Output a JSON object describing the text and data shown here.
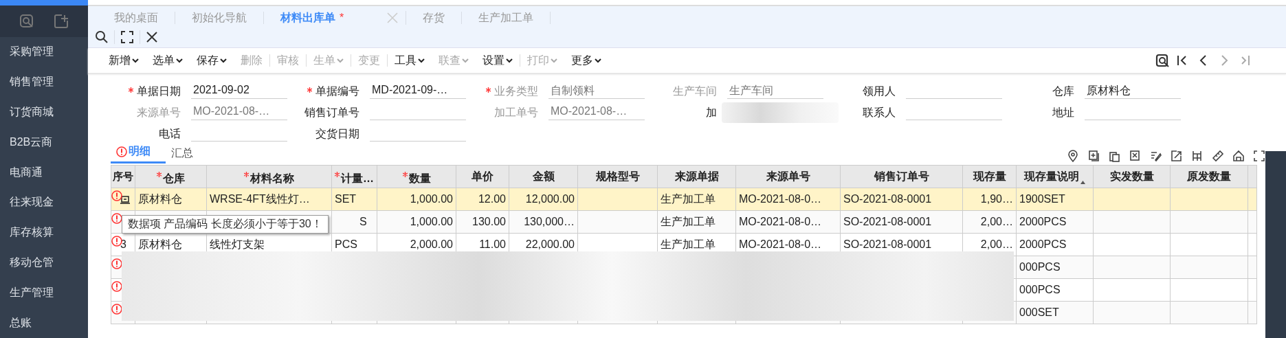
{
  "sidebar": {
    "items": [
      {
        "label": "采购管理"
      },
      {
        "label": "销售管理"
      },
      {
        "label": "订货商城"
      },
      {
        "label": "B2B云商"
      },
      {
        "label": "电商通"
      },
      {
        "label": "往来现金"
      },
      {
        "label": "库存核算"
      },
      {
        "label": "移动仓管"
      },
      {
        "label": "生产管理"
      },
      {
        "label": "总账"
      }
    ]
  },
  "tabs": [
    {
      "label": "我的桌面",
      "selected": false,
      "modified": false
    },
    {
      "label": "初始化导航",
      "selected": false,
      "modified": false
    },
    {
      "label": "材料出库单",
      "selected": true,
      "modified": true,
      "modified_mark": "*"
    },
    {
      "label": "存货",
      "selected": false,
      "modified": false
    },
    {
      "label": "生产加工单",
      "selected": false,
      "modified": false
    }
  ],
  "toolbar": {
    "buttons": [
      {
        "label": "新增",
        "dropdown": true,
        "disabled": false,
        "divider_after": false
      },
      {
        "label": "选单",
        "dropdown": true,
        "disabled": false,
        "divider_after": false
      },
      {
        "label": "保存",
        "dropdown": true,
        "disabled": false,
        "divider_after": false
      },
      {
        "label": "删除",
        "dropdown": false,
        "disabled": true,
        "divider_after": true
      },
      {
        "label": "审核",
        "dropdown": false,
        "disabled": true,
        "divider_after": true
      },
      {
        "label": "生单",
        "dropdown": true,
        "disabled": true,
        "divider_after": true
      },
      {
        "label": "变更",
        "dropdown": false,
        "disabled": true,
        "divider_after": true
      },
      {
        "label": "工具",
        "dropdown": true,
        "disabled": false,
        "divider_after": false
      },
      {
        "label": "联查",
        "dropdown": true,
        "disabled": true,
        "divider_after": false
      },
      {
        "label": "设置",
        "dropdown": true,
        "disabled": false,
        "divider_after": true
      },
      {
        "label": "打印",
        "dropdown": true,
        "disabled": true,
        "divider_after": false
      },
      {
        "label": "更多",
        "dropdown": true,
        "disabled": false,
        "divider_after": false
      }
    ],
    "nav": [
      {
        "kind": "first",
        "disabled": false
      },
      {
        "kind": "prev",
        "disabled": false
      },
      {
        "kind": "next",
        "disabled": true
      },
      {
        "kind": "last",
        "disabled": true
      }
    ]
  },
  "form": {
    "fields": [
      {
        "label": "单据日期",
        "value": "2021-09-02",
        "required": true,
        "disabled": false
      },
      {
        "label": "单据编号",
        "value": "MD-2021-09-…",
        "required": true,
        "disabled": false
      },
      {
        "label": "业务类型",
        "value": "自制领料",
        "required": true,
        "disabled": true
      },
      {
        "label": "生产车间",
        "value": "生产车间",
        "required": false,
        "disabled": true
      },
      {
        "label": "领用人",
        "required": false,
        "disabled": false
      },
      {
        "label": "仓库",
        "value": "原材料仓",
        "required": false,
        "disabled": false
      },
      {
        "label": "来源单号",
        "value": "MO-2021-08-…",
        "required": false,
        "disabled": true
      },
      {
        "label": "销售订单号",
        "required": false,
        "disabled": false
      },
      {
        "label": "加工单号",
        "value": "MO-2021-08-…",
        "required": false,
        "disabled": true
      },
      {
        "label": "加",
        "required": false,
        "disabled": false,
        "blurred": true
      },
      {
        "label": "联系人",
        "required": false,
        "disabled": false
      },
      {
        "label": "地址",
        "required": false,
        "disabled": false
      },
      {
        "label": "电话",
        "required": false,
        "disabled": false
      },
      {
        "label": "交货日期",
        "required": false,
        "disabled": false
      }
    ]
  },
  "detail_tabs": [
    {
      "label": "明细",
      "selected": true,
      "error": true
    },
    {
      "label": "汇总",
      "selected": false,
      "error": false
    }
  ],
  "table": {
    "columns": [
      {
        "label": "序号",
        "required": false
      },
      {
        "label": "仓库",
        "required": true
      },
      {
        "label": "材料名称",
        "required": true
      },
      {
        "label": "计量…",
        "required": true
      },
      {
        "label": "数量",
        "required": true
      },
      {
        "label": "单价",
        "required": false
      },
      {
        "label": "金额",
        "required": false
      },
      {
        "label": "规格型号",
        "required": false
      },
      {
        "label": "来源单据",
        "required": false
      },
      {
        "label": "来源单号",
        "required": false
      },
      {
        "label": "销售订单号",
        "required": false
      },
      {
        "label": "现存量",
        "required": false
      },
      {
        "label": "现存量说明",
        "required": false,
        "sorted": true
      },
      {
        "label": "实发数量",
        "required": false
      },
      {
        "label": "原发数量",
        "required": false
      }
    ],
    "rows": [
      {
        "selected": true,
        "error": true,
        "editing": true,
        "cells": [
          null,
          "原材料仓",
          "WRSE-4FT线性灯…",
          "SET",
          "1,000.00",
          "12.00",
          "12,000.00",
          null,
          "生产加工单",
          "MO-2021-08-0…",
          "SO-2021-08-0001",
          "1,90…",
          "1900SET",
          null,
          null
        ]
      },
      {
        "selected": false,
        "error": true,
        "editing": false,
        "tooltip": "数据项 产品编码 长度必须小于等于30！",
        "cells": [
          null,
          null,
          null,
          "S",
          "1,000.00",
          "130.00",
          "130,000…",
          null,
          "生产加工单",
          "MO-2021-08-0…",
          "SO-2021-08-0001",
          "2,00…",
          "2000PCS",
          null,
          null
        ]
      },
      {
        "selected": false,
        "error": true,
        "editing": false,
        "cells": [
          "3",
          "原材料仓",
          "线性灯支架",
          "PCS",
          "2,000.00",
          "11.00",
          "22,000.00",
          null,
          "生产加工单",
          "MO-2021-08-0…",
          "SO-2021-08-0001",
          "2,00…",
          "2000PCS",
          null,
          null
        ]
      },
      {
        "selected": false,
        "error": true,
        "editing": false,
        "cells": [
          null,
          null,
          null,
          null,
          null,
          null,
          null,
          null,
          null,
          null,
          null,
          null,
          "000PCS",
          null,
          null
        ]
      },
      {
        "selected": false,
        "error": true,
        "editing": false,
        "cells": [
          null,
          null,
          null,
          null,
          null,
          null,
          null,
          null,
          null,
          null,
          null,
          null,
          "000PCS",
          null,
          null
        ]
      },
      {
        "selected": false,
        "error": true,
        "editing": false,
        "cells": [
          null,
          null,
          null,
          null,
          null,
          null,
          null,
          null,
          null,
          null,
          null,
          null,
          "000SET",
          null,
          null
        ]
      }
    ]
  }
}
